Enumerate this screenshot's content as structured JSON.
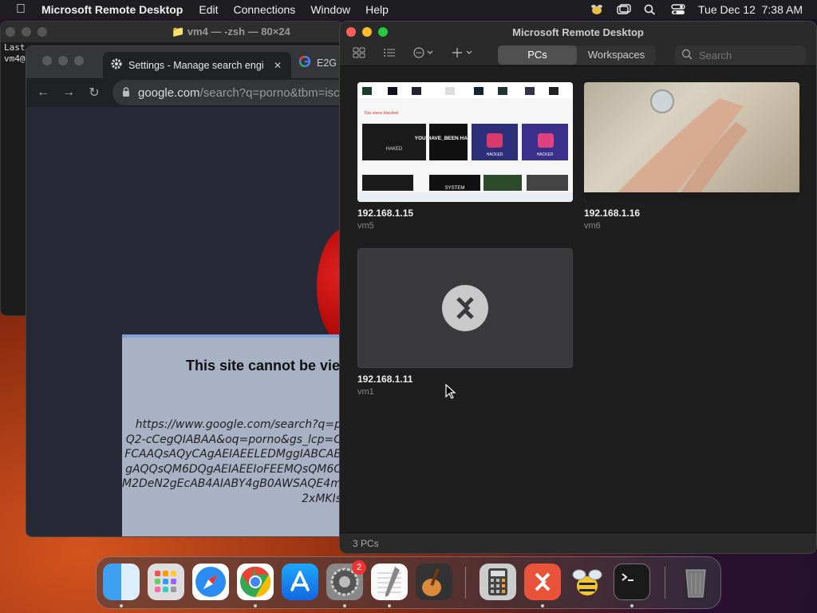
{
  "menubar": {
    "app_name": "Microsoft Remote Desktop",
    "menus": [
      "Edit",
      "Connections",
      "Window",
      "Help"
    ],
    "datetime": "Tue Dec 12  7:38 AM"
  },
  "terminal": {
    "title": "vm4 — -zsh — 80×24",
    "lines": [
      "Last",
      "vm4@"
    ]
  },
  "chrome": {
    "tab1_title": "Settings - Manage search engi",
    "tab2_title": "E2G",
    "url_host": "google.com",
    "url_path": "/search?q=porno&tbm=isc",
    "dialog_title": "This site cannot be vie",
    "dialog_url_lines": [
      "https://www.google.com/search?q=p",
      "Q2-cCegQIABAA&oq=porno&gs_lcp=C",
      "FCAAQsAQyCAgAEIAEELEDMggIABCAB",
      "gAQQsQM6DQgAEIAEEIoFEEMQsQM6C",
      "M2DeN2gEcAB4AIABY4gB0AWSAQE4mA",
      "2xMKIs"
    ]
  },
  "rd": {
    "title": "Microsoft Remote Desktop",
    "tabs": [
      "PCs",
      "Workspaces"
    ],
    "search_placeholder": "Search",
    "pcs": [
      {
        "ip": "192.168.1.15",
        "name": "vm5"
      },
      {
        "ip": "192.168.1.16",
        "name": "vm6"
      },
      {
        "ip": "192.168.1.11",
        "name": "vm1"
      }
    ],
    "status": "3 PCs",
    "vm5_thumb": {
      "alert": "You were Hacked",
      "tiles": [
        "HAKED",
        "YOU HAVE_BEEN HACKED",
        "HACKED",
        "HACKED",
        "SYSTEM"
      ]
    }
  },
  "dock": {
    "items": [
      "finder-icon",
      "launchpad-icon",
      "safari-icon",
      "chrome-icon",
      "app-store-icon",
      "system-settings-icon",
      "textedit-icon",
      "garageband-icon",
      "calculator-icon",
      "remote-desktop-icon",
      "cyberduck-icon",
      "terminal-icon",
      "trash-icon"
    ],
    "settings_badge": "2"
  }
}
